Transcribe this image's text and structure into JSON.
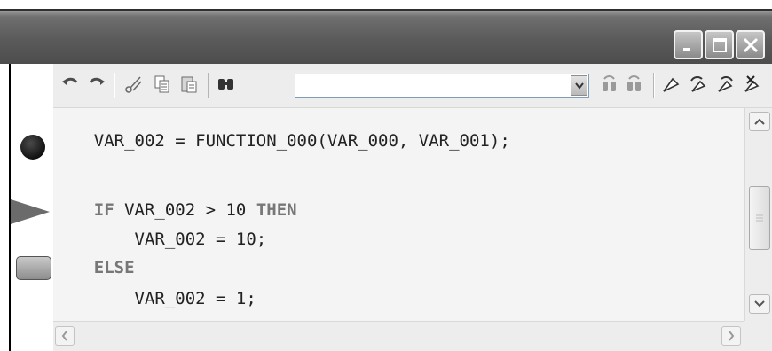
{
  "window": {
    "controls": [
      {
        "name": "minimize-button",
        "icon": "minimize-icon"
      },
      {
        "name": "maximize-button",
        "icon": "maximize-icon"
      },
      {
        "name": "close-button",
        "icon": "close-icon"
      }
    ]
  },
  "toolbar": {
    "icons": [
      "undo-icon",
      "redo-icon",
      "cut-icon",
      "copy-icon",
      "paste-icon",
      "find-icon",
      "find-previous-icon",
      "find-next-icon",
      "toggle-bookmark-icon",
      "previous-bookmark-icon",
      "next-bookmark-icon",
      "clear-bookmarks-icon"
    ],
    "search_value": ""
  },
  "code": {
    "lines": [
      {
        "parts": [
          {
            "t": "    VAR_002 = FUNCTION_000(VAR_000, VAR_001);",
            "kw": false
          }
        ]
      },
      {
        "parts": []
      },
      {
        "parts": [
          {
            "t": "    ",
            "kw": false
          },
          {
            "t": "IF",
            "kw": true
          },
          {
            "t": " VAR_002 > 10 ",
            "kw": false
          },
          {
            "t": "THEN",
            "kw": true
          }
        ]
      },
      {
        "parts": [
          {
            "t": "        VAR_002 = 10;",
            "kw": false
          }
        ]
      },
      {
        "parts": [
          {
            "t": "    ",
            "kw": false
          },
          {
            "t": "ELSE",
            "kw": true
          }
        ]
      },
      {
        "parts": [
          {
            "t": "        VAR_002 = 1;",
            "kw": false
          }
        ]
      }
    ]
  },
  "gutter_markers": [
    "breakpoint-icon",
    "current-line-arrow-icon",
    "bookmark-marker-icon"
  ],
  "colors": {
    "keyword": "#777777",
    "text": "#222222",
    "editor_bg": "#f4f4f4"
  }
}
